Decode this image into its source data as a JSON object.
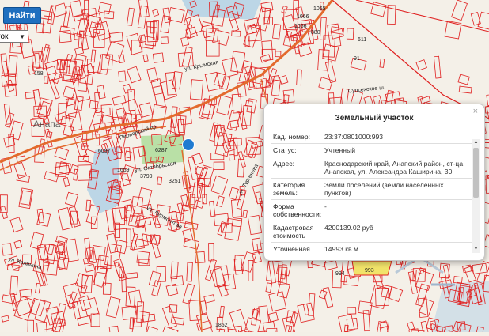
{
  "toolbar": {
    "find_label": "Найти",
    "select_value": "ток"
  },
  "map": {
    "town_label": "Анапа",
    "parcel_labels": [
      "1065",
      "1066",
      "1056",
      "880",
      "611",
      "91",
      "158",
      "6097",
      "6287",
      "3799",
      "1659",
      "3251",
      "994",
      "993",
      "1852"
    ],
    "street_labels": [
      "Пионерский пр.",
      "ул. Крымская",
      "ул. Лермонтова",
      "ул. Тургенева",
      "ул. Октябрьская",
      "Супсехское ш.",
      "ул. Калинина"
    ],
    "parcel_color": "#e02020",
    "road_color": "#e36a2d",
    "green_color": "#b9e0a6",
    "water_color": "#bcd6e6"
  },
  "popup": {
    "title": "Земельный участок",
    "close_icon": "×",
    "rows": [
      {
        "key": "Кад. номер:",
        "value": "23:37:0801000:993"
      },
      {
        "key": "Статус:",
        "value": "Учтенный"
      },
      {
        "key": "Адрес:",
        "value": "Краснодарский край, Анапский район, ст-ца Анапская, ул. Александра Каширина, 30"
      },
      {
        "key": "Категория земель:",
        "value": "Земли поселений (земли населенных пунктов)"
      },
      {
        "key": "Форма собственности:",
        "value": "-"
      },
      {
        "key": "Кадастровая стоимость",
        "value": "4200139.02 руб"
      },
      {
        "key": "Уточненная площадь:",
        "value": "14993 кв.м"
      }
    ]
  }
}
